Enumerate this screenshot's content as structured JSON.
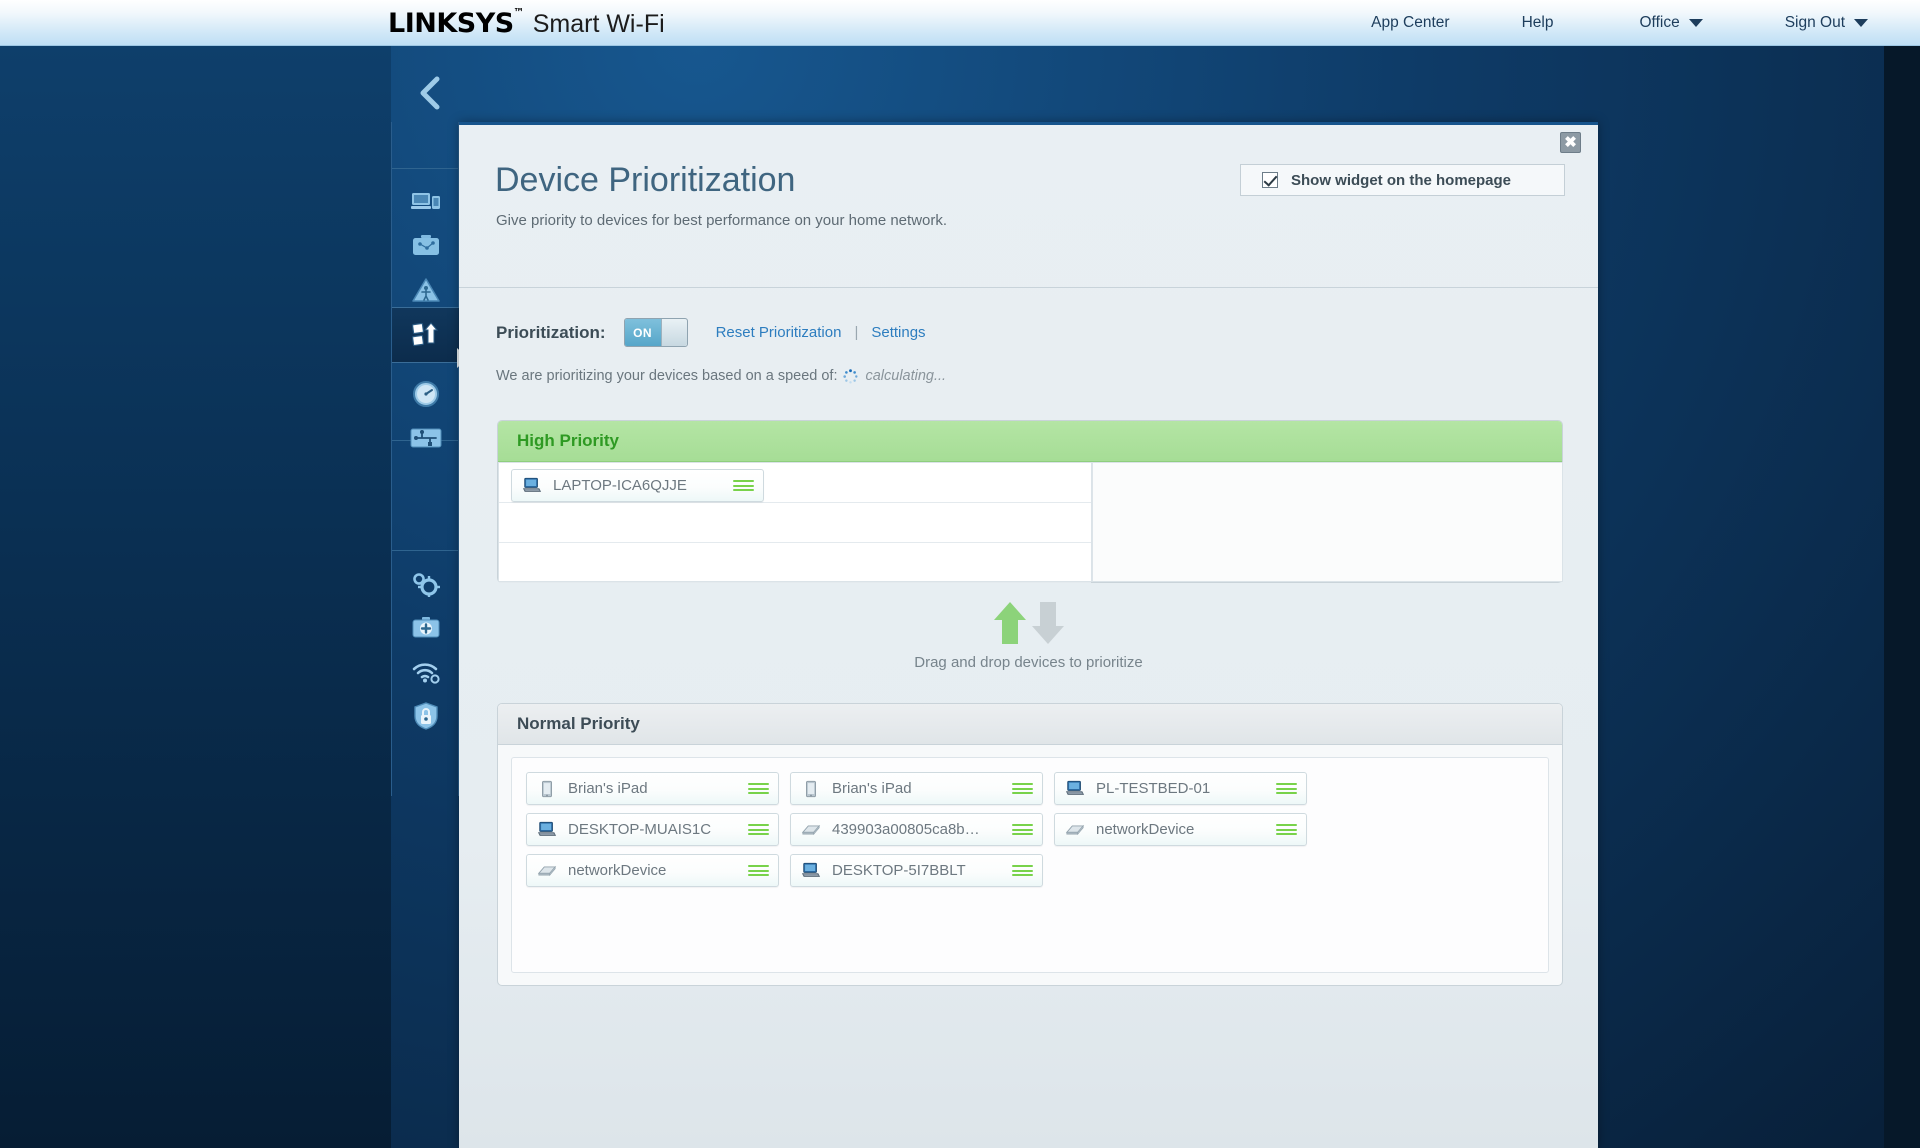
{
  "topbar": {
    "brand_main": "LINKSYS",
    "brand_tm": "™",
    "brand_sub": "Smart Wi-Fi",
    "nav": [
      {
        "label": "App Center",
        "has_caret": false
      },
      {
        "label": "Help",
        "has_caret": false
      },
      {
        "label": "Office",
        "has_caret": true
      },
      {
        "label": "Sign Out",
        "has_caret": true
      }
    ]
  },
  "sidebar": {
    "back_icon": "chevron-left-icon",
    "items": [
      {
        "icon": "device-list-icon",
        "name": "device-list"
      },
      {
        "icon": "guest-access-icon",
        "name": "guest-access"
      },
      {
        "icon": "parental-controls-icon",
        "name": "parental-controls"
      },
      {
        "icon": "device-prioritization-icon",
        "name": "device-prioritization",
        "active": true
      },
      {
        "icon": "speed-test-icon",
        "name": "speed-test"
      },
      {
        "icon": "usb-storage-icon",
        "name": "usb-storage"
      },
      {
        "icon": "connectivity-icon",
        "name": "connectivity"
      },
      {
        "icon": "troubleshooting-icon",
        "name": "troubleshooting"
      },
      {
        "icon": "wireless-icon",
        "name": "wireless"
      },
      {
        "icon": "security-icon",
        "name": "security"
      }
    ]
  },
  "page": {
    "title": "Device Prioritization",
    "subtitle": "Give priority to devices for best performance on your home network.",
    "close_label": "✖",
    "widget_checkbox_label": "Show widget on the homepage",
    "widget_checked": true
  },
  "prioritization": {
    "label": "Prioritization:",
    "toggle_state": "ON",
    "reset_link": "Reset Prioritization",
    "divider": "|",
    "settings_link": "Settings",
    "speed_prefix": "We are prioritizing your devices based on a speed of:",
    "speed_value": "calculating..."
  },
  "high_priority": {
    "header": "High Priority",
    "devices": [
      {
        "name": "LAPTOP-ICA6QJJE",
        "icon": "laptop-icon"
      }
    ]
  },
  "drag_hint": {
    "text": "Drag and drop devices to prioritize",
    "up_arrow_color": "#8cd37a",
    "down_arrow_color": "#c8d0d4"
  },
  "normal_priority": {
    "header": "Normal Priority",
    "devices": [
      {
        "name": "Brian's iPad",
        "icon": "tablet-icon"
      },
      {
        "name": "Brian's iPad",
        "icon": "tablet-icon"
      },
      {
        "name": "PL-TESTBED-01",
        "icon": "desktop-icon"
      },
      {
        "name": "DESKTOP-MUAIS1C",
        "icon": "desktop-icon"
      },
      {
        "name": "439903a00805ca8b…",
        "icon": "generic-device-icon"
      },
      {
        "name": "networkDevice",
        "icon": "generic-device-icon"
      },
      {
        "name": "networkDevice",
        "icon": "generic-device-icon"
      },
      {
        "name": "DESKTOP-5I7BBLT",
        "icon": "desktop-icon"
      }
    ]
  },
  "colors": {
    "brand_blue": "#17548c",
    "accent_link": "#2d7dbf",
    "high_priority_green": "#2e9a23",
    "grip_green": "#78d24a",
    "title_color": "#3f6580"
  }
}
